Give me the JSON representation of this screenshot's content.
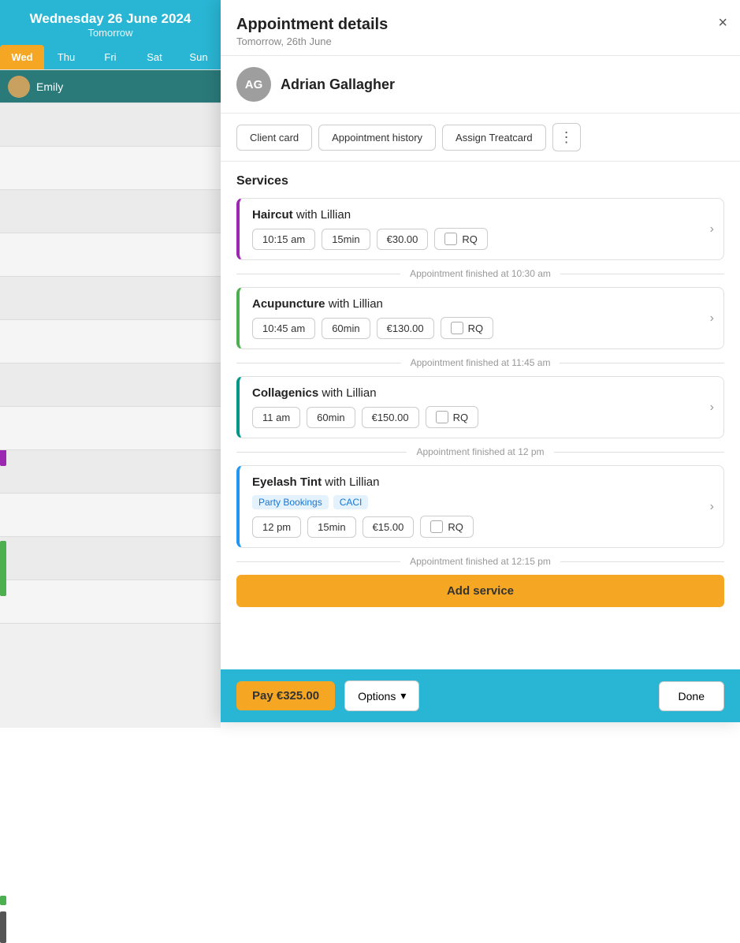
{
  "calendar": {
    "date_main": "Wednesday 26 June 2024",
    "date_sub": "Tomorrow",
    "days": [
      {
        "label": "Wed",
        "active": true
      },
      {
        "label": "Thu",
        "active": false
      },
      {
        "label": "Fri",
        "active": false
      },
      {
        "label": "Sat",
        "active": false
      },
      {
        "label": "Sun",
        "active": false
      }
    ],
    "staff_name": "Emily"
  },
  "modal": {
    "title": "Appointment details",
    "subtitle": "Tomorrow, 26th June",
    "close_label": "×",
    "client": {
      "initials": "AG",
      "name": "Adrian Gallagher"
    },
    "actions": {
      "client_card": "Client card",
      "appointment_history": "Appointment history",
      "assign_treatcard": "Assign Treatcard",
      "more_icon": "⋮"
    },
    "services_title": "Services",
    "services": [
      {
        "name": "Haircut",
        "with": "with Lillian",
        "time": "10:15 am",
        "duration": "15min",
        "price": "€30.00",
        "rq": "RQ",
        "border_color": "purple",
        "finished_at": "Appointment finished at 10:30 am",
        "tags": []
      },
      {
        "name": "Acupuncture",
        "with": "with Lillian",
        "time": "10:45 am",
        "duration": "60min",
        "price": "€130.00",
        "rq": "RQ",
        "border_color": "green",
        "finished_at": "Appointment finished at 11:45 am",
        "tags": []
      },
      {
        "name": "Collagenics",
        "with": "with Lillian",
        "time": "11 am",
        "duration": "60min",
        "price": "€150.00",
        "rq": "RQ",
        "border_color": "teal",
        "finished_at": "Appointment finished at 12 pm",
        "tags": []
      },
      {
        "name": "Eyelash Tint",
        "with": "with Lillian",
        "time": "12 pm",
        "duration": "15min",
        "price": "€15.00",
        "rq": "RQ",
        "border_color": "blue",
        "finished_at": "Appointment finished at 12:15 pm",
        "tags": [
          "Party Bookings",
          "CACI"
        ]
      }
    ],
    "add_service_label": "Add service",
    "footer": {
      "pay_label": "Pay €325.00",
      "options_label": "Options",
      "done_label": "Done",
      "chevron": "▾"
    }
  }
}
